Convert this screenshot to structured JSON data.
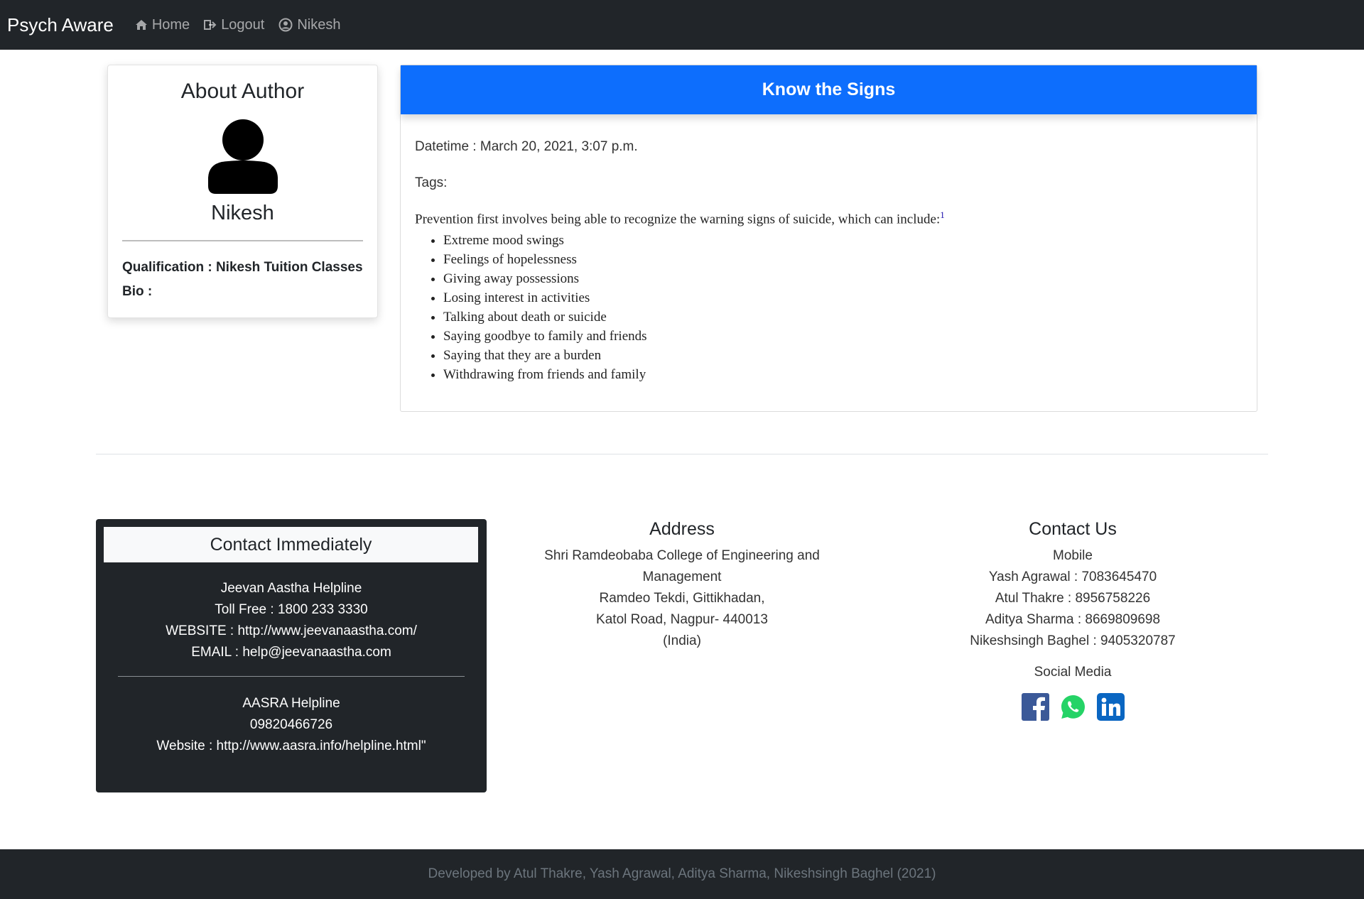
{
  "navbar": {
    "brand": "Psych Aware",
    "links": [
      {
        "label": "Home",
        "icon": "home-icon"
      },
      {
        "label": "Logout",
        "icon": "logout-icon"
      },
      {
        "label": "Nikesh",
        "icon": "user-circle-icon"
      }
    ]
  },
  "author": {
    "title": "About Author",
    "name": "Nikesh",
    "qualification": "Qualification : Nikesh Tuition Classes",
    "bio": "Bio :"
  },
  "post": {
    "title": "Know the Signs",
    "datetime": "Datetime : March 20, 2021, 3:07 p.m.",
    "tags": "Tags:",
    "intro": "Prevention first involves being able to recognize the warning signs of suicide, which can include:",
    "footnote": "1",
    "signs": [
      "Extreme mood swings",
      "Feelings of hopelessness",
      "Giving away possessions",
      "Losing interest in activities",
      "Talking about death or suicide",
      "Saying goodbye to family and friends",
      "Saying that they are a burden",
      "Withdrawing from friends and family"
    ]
  },
  "contact_immediately": {
    "title": "Contact Immediately",
    "block1": [
      "Jeevan Aastha Helpline",
      "Toll Free : 1800 233 3330",
      "WEBSITE : http://www.jeevanaastha.com/",
      "EMAIL : help@jeevanaastha.com"
    ],
    "block2": [
      "AASRA Helpline",
      "09820466726",
      "Website : http://www.aasra.info/helpline.html\""
    ]
  },
  "address": {
    "title": "Address",
    "lines": [
      "Shri Ramdeobaba College of Engineering and",
      "Management",
      "Ramdeo Tekdi, Gittikhadan,",
      "Katol Road, Nagpur- 440013",
      "(India)"
    ]
  },
  "contact_us": {
    "title": "Contact Us",
    "mobile_label": "Mobile",
    "contacts": [
      "Yash Agrawal : 7083645470",
      "Atul Thakre : 8956758226",
      "Aditya Sharma : 8669809698",
      "Nikeshsingh Baghel : 9405320787"
    ],
    "social_label": "Social Media",
    "social": [
      "facebook-icon",
      "whatsapp-icon",
      "linkedin-icon"
    ]
  },
  "footer": {
    "text": "Developed by Atul Thakre, Yash Agrawal, Aditya Sharma, Nikeshsingh Baghel (2021)"
  },
  "colors": {
    "navbar": "#212529",
    "primary": "#0d6efd",
    "facebook": "#3b5998",
    "whatsapp": "#25d366",
    "linkedin": "#0a66c2"
  }
}
